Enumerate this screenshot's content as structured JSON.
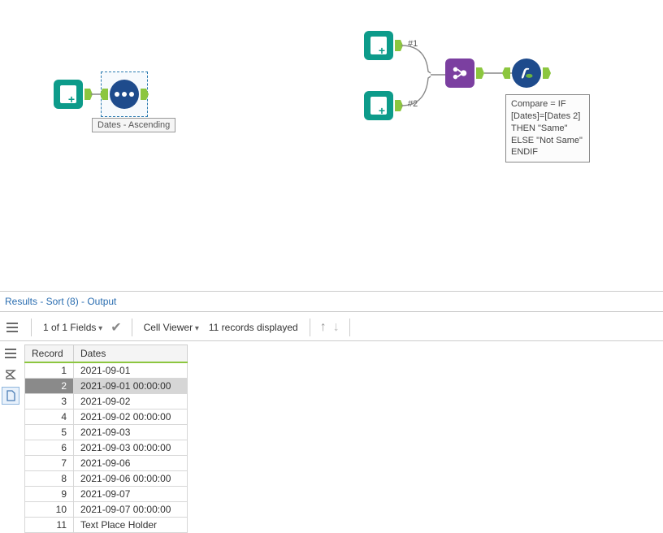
{
  "canvas": {
    "sort_label": "Dates - Ascending",
    "join_anchor1": "#1",
    "join_anchor2": "#2",
    "formula_annotation": "Compare = IF\n[Dates]=[Dates 2]\nTHEN \"Same\"\nELSE \"Not Same\"\nENDIF"
  },
  "results": {
    "title": "Results - Sort (8) - Output",
    "fields_label": "1 of 1 Fields",
    "cell_viewer_label": "Cell Viewer",
    "records_label": "11 records displayed"
  },
  "grid": {
    "columns": [
      "Record",
      "Dates"
    ],
    "rows": [
      {
        "rec": "1",
        "val": "2021-09-01"
      },
      {
        "rec": "2",
        "val": "2021-09-01 00:00:00",
        "selected": true
      },
      {
        "rec": "3",
        "val": "2021-09-02"
      },
      {
        "rec": "4",
        "val": "2021-09-02 00:00:00"
      },
      {
        "rec": "5",
        "val": "2021-09-03"
      },
      {
        "rec": "6",
        "val": "2021-09-03 00:00:00"
      },
      {
        "rec": "7",
        "val": "2021-09-06"
      },
      {
        "rec": "8",
        "val": "2021-09-06 00:00:00"
      },
      {
        "rec": "9",
        "val": "2021-09-07"
      },
      {
        "rec": "10",
        "val": "2021-09-07 00:00:00"
      },
      {
        "rec": "11",
        "val": "Text Place Holder"
      }
    ]
  }
}
